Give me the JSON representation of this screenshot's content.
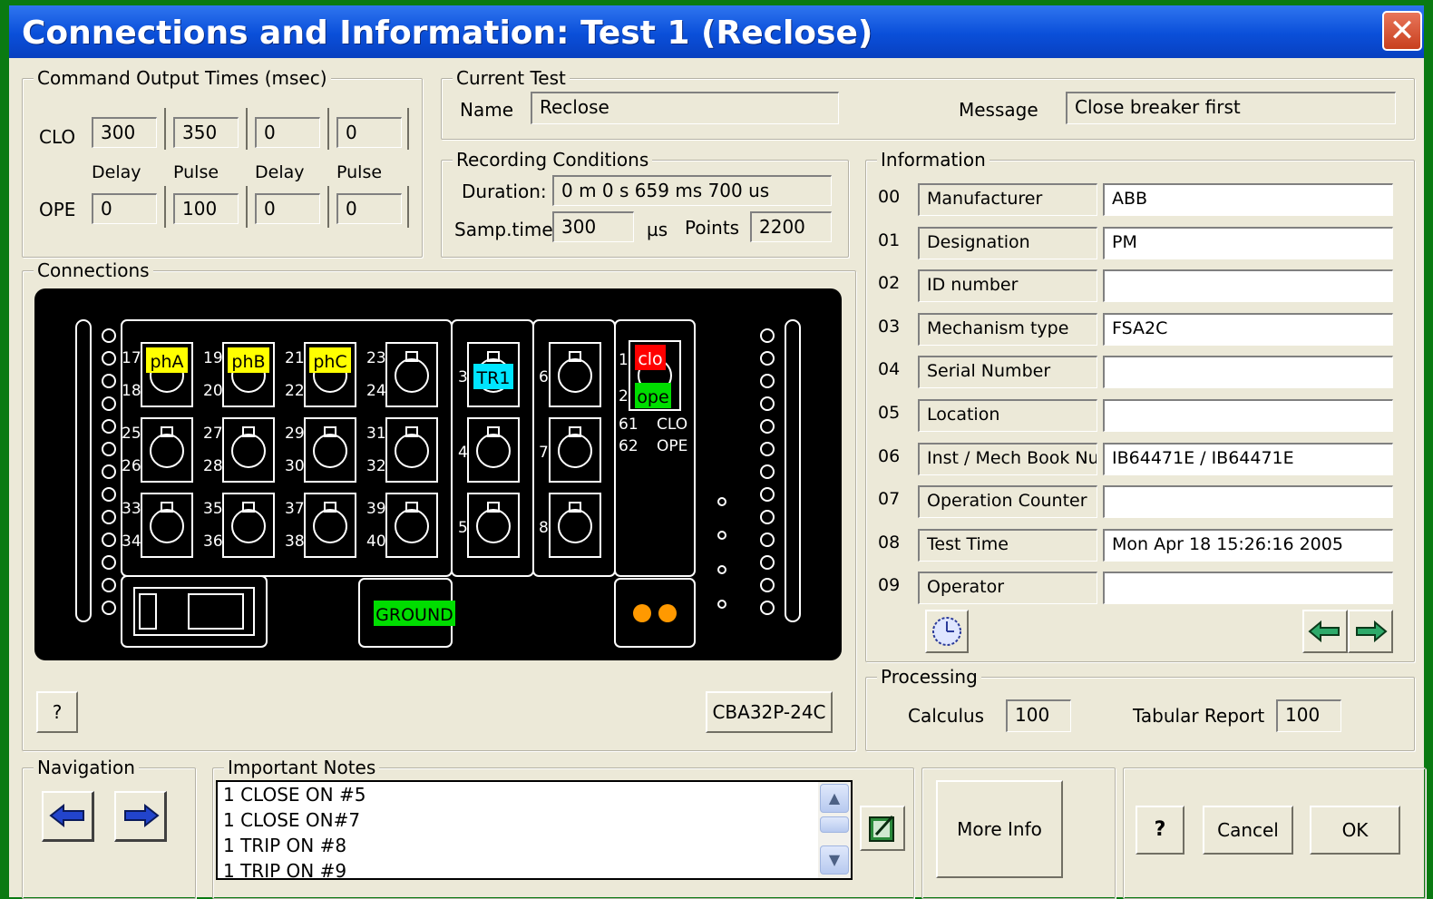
{
  "window": {
    "title": "Connections and Information: Test 1 (Reclose)",
    "close_glyph": "✕"
  },
  "command_output": {
    "legend": "Command Output Times (msec)",
    "clo_label": "CLO",
    "ope_label": "OPE",
    "clo_values": [
      "300",
      "350",
      "0",
      "0"
    ],
    "ope_values": [
      "0",
      "100",
      "0",
      "0"
    ],
    "column_labels": [
      "Delay",
      "Pulse",
      "Delay",
      "Pulse"
    ]
  },
  "current_test": {
    "legend": "Current Test",
    "name_label": "Name",
    "name_value": "Reclose",
    "message_label": "Message",
    "message_value": "Close breaker first"
  },
  "recording": {
    "legend": "Recording Conditions",
    "duration_label": "Duration:",
    "duration_value": "0 m 0 s 659 ms 700 us",
    "samp_label": "Samp.time",
    "samp_value": "300",
    "samp_unit": "µs",
    "points_label": "Points",
    "points_value": "2200"
  },
  "connections": {
    "legend": "Connections",
    "help_label": "?",
    "device_label": "CBA32P-24C",
    "terminal_numbers": [
      "17",
      "18",
      "19",
      "20",
      "21",
      "22",
      "23",
      "24",
      "25",
      "26",
      "27",
      "28",
      "29",
      "30",
      "31",
      "32",
      "33",
      "34",
      "35",
      "36",
      "37",
      "38",
      "39",
      "40",
      "3",
      "4",
      "5",
      "6",
      "7",
      "8",
      "1",
      "2",
      "61",
      "62"
    ],
    "channel_tags": {
      "phA": "phA",
      "phB": "phB",
      "phC": "phC",
      "tr1": "TR1",
      "clo": "clo",
      "ope": "ope",
      "ground": "GROUND"
    },
    "output_labels": {
      "clo": "CLO",
      "ope": "OPE"
    },
    "colors": {
      "yellow": "#ffff00",
      "cyan": "#00e5ff",
      "red": "#ff0000",
      "green": "#00dd00",
      "orange": "#ff9900"
    }
  },
  "information": {
    "legend": "Information",
    "rows": [
      {
        "num": "00",
        "field": "Manufacturer",
        "value": "ABB"
      },
      {
        "num": "01",
        "field": "Designation",
        "value": "PM"
      },
      {
        "num": "02",
        "field": "ID number",
        "value": ""
      },
      {
        "num": "03",
        "field": "Mechanism type",
        "value": "FSA2C"
      },
      {
        "num": "04",
        "field": "Serial Number",
        "value": ""
      },
      {
        "num": "05",
        "field": "Location",
        "value": ""
      },
      {
        "num": "06",
        "field": "Inst / Mech Book Nu",
        "value": "IB64471E / IB64471E"
      },
      {
        "num": "07",
        "field": "Operation Counter",
        "value": ""
      },
      {
        "num": "08",
        "field": "Test Time",
        "value": "Mon Apr 18 15:26:16 2005"
      },
      {
        "num": "09",
        "field": "Operator",
        "value": ""
      }
    ],
    "icons": [
      "clock-icon",
      "arrow-left-green-icon",
      "arrow-right-green-icon"
    ]
  },
  "processing": {
    "legend": "Processing",
    "calculus_label": "Calculus",
    "calculus_value": "100",
    "tabular_label": "Tabular Report",
    "tabular_value": "100"
  },
  "navigation": {
    "legend": "Navigation",
    "icons": [
      "arrow-left-icon",
      "arrow-right-icon"
    ]
  },
  "notes": {
    "legend": "Important Notes",
    "lines": [
      "1 CLOSE ON #5",
      "1 CLOSE ON#7",
      "1 TRIP ON #8",
      "1 TRIP ON #9"
    ]
  },
  "buttons": {
    "more_info": "More Info",
    "help": "?",
    "cancel": "Cancel",
    "ok": "OK"
  }
}
